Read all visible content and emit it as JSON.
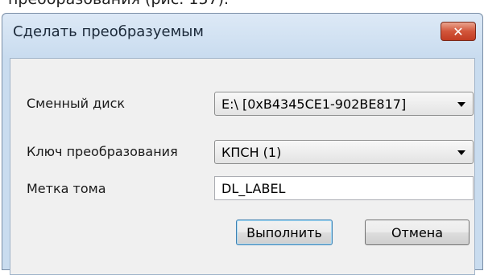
{
  "document": {
    "caption_fragment": "преобразования (рис. 157)."
  },
  "dialog": {
    "title": "Сделать преобразуемым",
    "close_glyph": "✕"
  },
  "form": {
    "removable_disk": {
      "label": "Сменный диск",
      "value": "E:\\ [0xB4345CE1-902BE817]"
    },
    "transform_key": {
      "label": "Ключ преобразования",
      "value": "КПСН (1)"
    },
    "volume_label": {
      "label": "Метка тома",
      "value": "DL_LABEL"
    }
  },
  "buttons": {
    "execute": "Выполнить",
    "cancel": "Отмена"
  },
  "colors": {
    "titlebar": "#c9dcef",
    "close_button": "#c23c22",
    "client_bg": "#f0f0f0",
    "default_button_border": "#3c7fb1"
  },
  "icons": {
    "close": "close-icon",
    "dropdown": "chevron-down-icon"
  }
}
